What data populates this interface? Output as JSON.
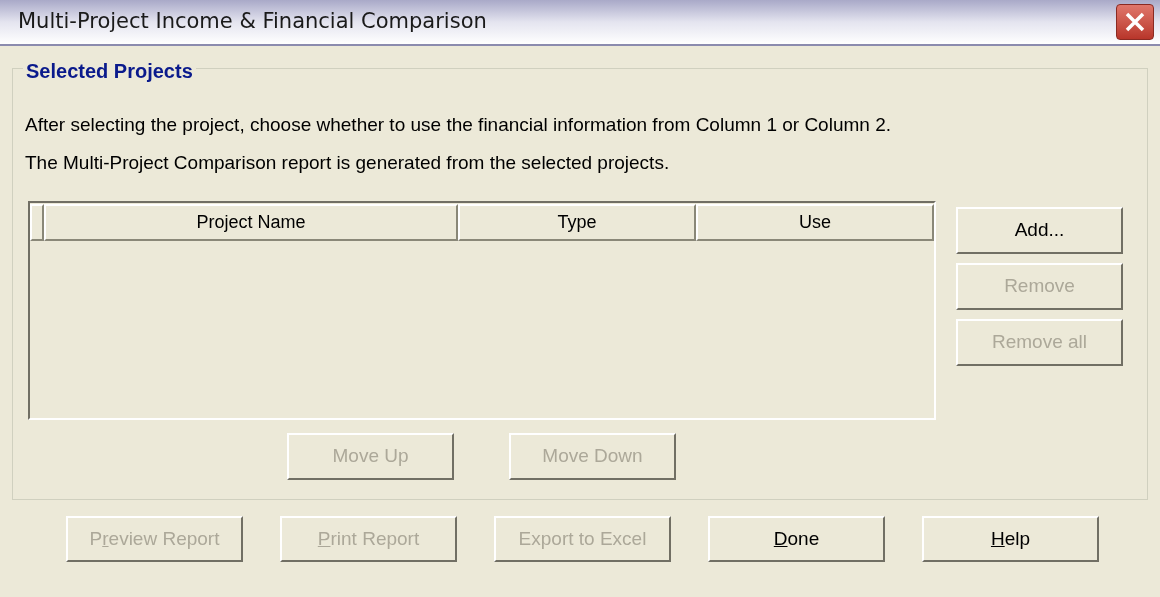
{
  "window": {
    "title": "Multi-Project Income & Financial Comparison"
  },
  "group": {
    "title": "Selected Projects",
    "lines": [
      "After selecting the project, choose whether to use the financial information from Column 1 or Column 2.",
      "The Multi-Project Comparison report is generated from the selected projects."
    ]
  },
  "table": {
    "columns": [
      "Project Name",
      "Type",
      "Use"
    ]
  },
  "side_buttons": [
    {
      "label": "Add...",
      "disabled": false
    },
    {
      "label": "Remove",
      "disabled": true
    },
    {
      "label": "Remove all",
      "disabled": true
    }
  ],
  "move_buttons": [
    {
      "label": "Move Up",
      "disabled": true
    },
    {
      "label": "Move Down",
      "disabled": true
    }
  ],
  "footer_buttons": [
    {
      "parts": [
        {
          "text": "P",
          "underlined": false
        },
        {
          "text": "r",
          "underlined": true
        },
        {
          "text": "eview Report",
          "underlined": false
        }
      ],
      "disabled": true
    },
    {
      "parts": [
        {
          "text": "P",
          "underlined": true
        },
        {
          "text": "rint Report",
          "underlined": false
        }
      ],
      "disabled": true
    },
    {
      "parts": [
        {
          "text": "Export to Excel",
          "underlined": false
        }
      ],
      "disabled": true
    },
    {
      "parts": [
        {
          "text": "D",
          "underlined": true
        },
        {
          "text": "one",
          "underlined": false
        }
      ],
      "disabled": false
    },
    {
      "parts": [
        {
          "text": "H",
          "underlined": true
        },
        {
          "text": "elp",
          "underlined": false
        }
      ],
      "disabled": false
    }
  ]
}
